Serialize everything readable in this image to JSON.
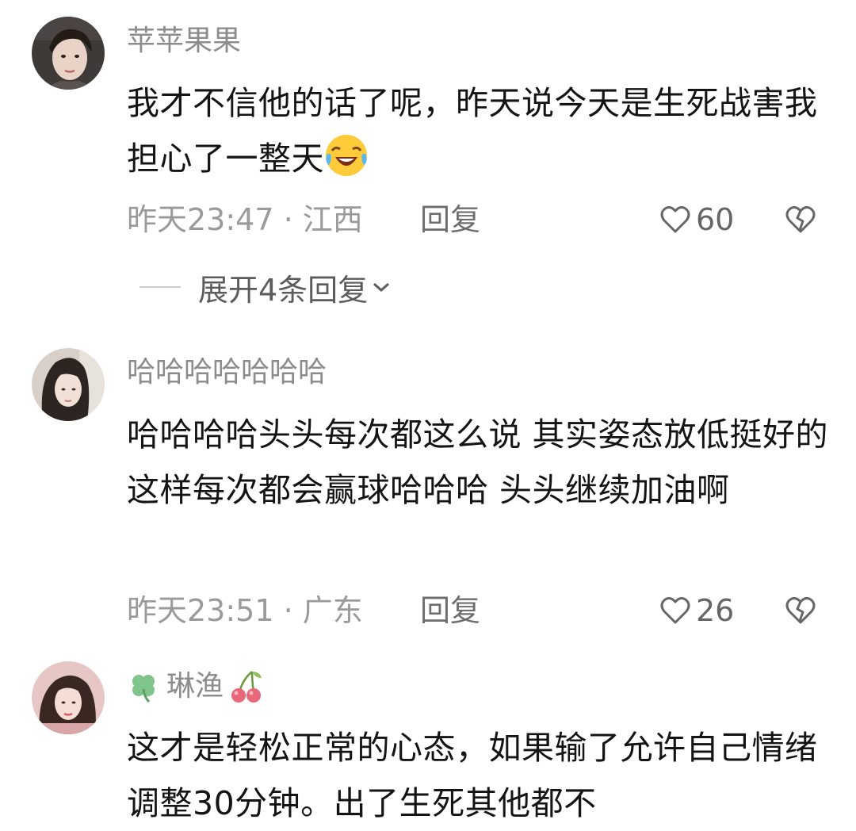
{
  "comments": [
    {
      "username": "苹苹果果",
      "text": "我才不信他的话了呢，昨天说今天是生死战害我担心了一整天",
      "emoji": "laughing-crying-emoji",
      "time": "昨天23:47",
      "separator": "·",
      "location": "江西",
      "reply_label": "回复",
      "likes": "60",
      "expand_label": "展开4条回复"
    },
    {
      "username": "哈哈哈哈哈哈哈",
      "text": "哈哈哈哈头头每次都这么说 其实姿态放低挺好的 这样每次都会赢球哈哈哈 头头继续加油啊",
      "time": "昨天23:51",
      "separator": "·",
      "location": "广东",
      "reply_label": "回复",
      "likes": "26"
    },
    {
      "username": "琳渔",
      "username_prefix_icon": "clover-icon",
      "username_suffix_icon": "cherry-icon",
      "text": "这才是轻松正常的心态，如果输了允许自己情绪调整30分钟。出了生死其他都不"
    }
  ],
  "colors": {
    "username": "#8c8c8c",
    "text": "#141414",
    "meta": "#9a9a9a",
    "reply": "#6e6e6e"
  }
}
